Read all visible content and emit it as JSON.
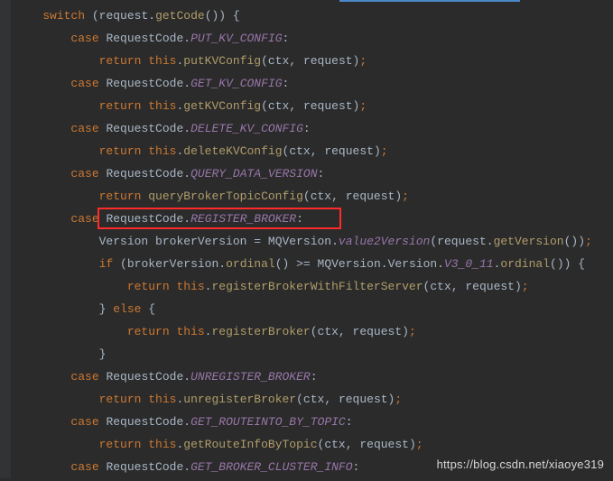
{
  "code": {
    "switch_kw": "switch",
    "request": "request",
    "getCode": "getCode",
    "case_kw": "case",
    "return_kw": "return",
    "this_kw": "this",
    "if_kw": "if",
    "else_kw": "else",
    "RequestCode": "RequestCode",
    "PUT_KV_CONFIG": "PUT_KV_CONFIG",
    "GET_KV_CONFIG": "GET_KV_CONFIG",
    "DELETE_KV_CONFIG": "DELETE_KV_CONFIG",
    "QUERY_DATA_VERSION": "QUERY_DATA_VERSION",
    "REGISTER_BROKER": "REGISTER_BROKER",
    "UNREGISTER_BROKER": "UNREGISTER_BROKER",
    "GET_ROUTEINTO_BY_TOPIC": "GET_ROUTEINTO_BY_TOPIC",
    "GET_BROKER_CLUSTER_INFO": "GET_BROKER_CLUSTER_INFO",
    "putKVConfig": "putKVConfig",
    "getKVConfig": "getKVConfig",
    "deleteKVConfig": "deleteKVConfig",
    "queryBrokerTopicConfig": "queryBrokerTopicConfig",
    "registerBrokerWithFilterServer": "registerBrokerWithFilterServer",
    "registerBroker": "registerBroker",
    "unregisterBroker": "unregisterBroker",
    "getRouteInfoByTopic": "getRouteInfoByTopic",
    "ctx": "ctx",
    "Version": "Version",
    "brokerVersion": "brokerVersion",
    "MQVersion": "MQVersion",
    "value2Version": "value2Version",
    "getVersion": "getVersion",
    "ordinal": "ordinal",
    "V3_0_11": "V3_0_11"
  },
  "watermark": "https://blog.csdn.net/xiaoye319"
}
